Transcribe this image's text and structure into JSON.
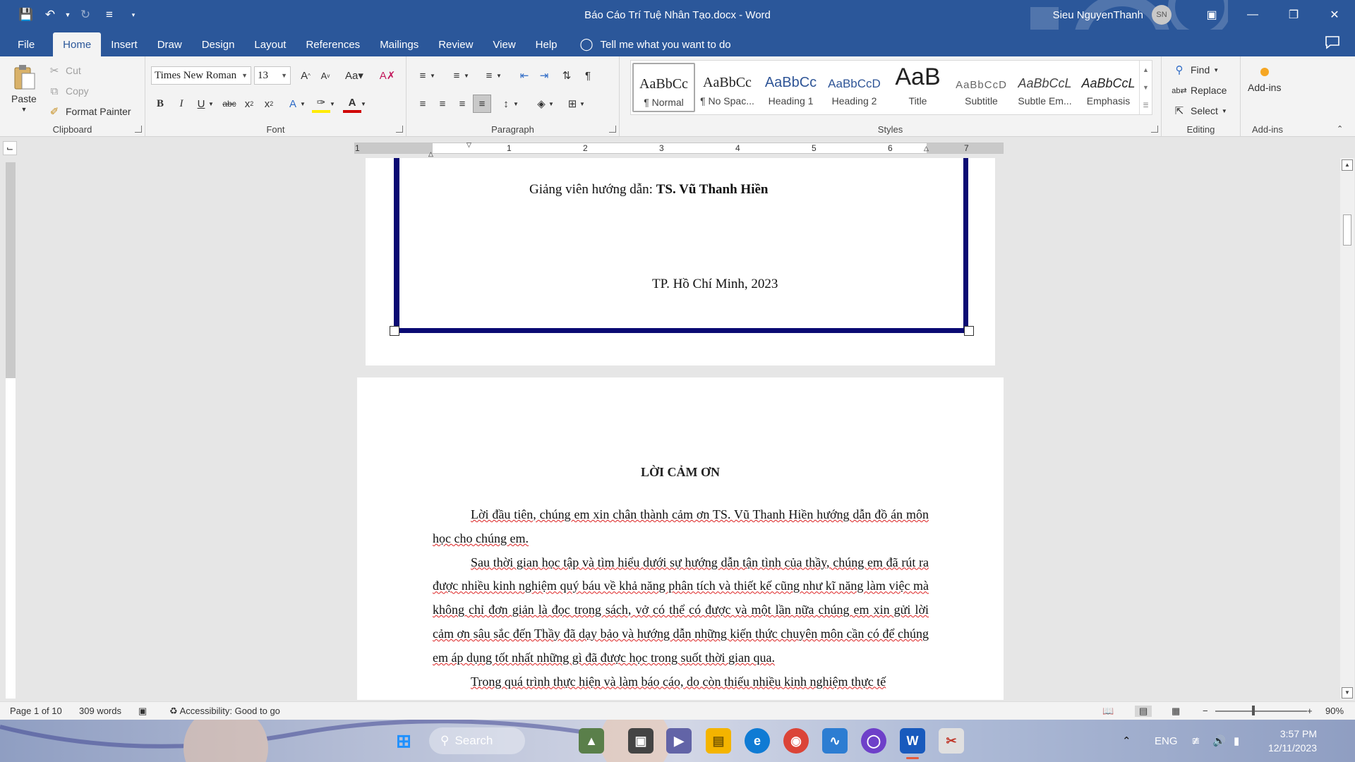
{
  "window": {
    "doc_title": "Báo Cáo Trí Tuệ Nhân Tạo.docx  -  Word",
    "user_name": "Sieu NguyenThanh",
    "user_initials": "SN"
  },
  "menu": {
    "tabs": [
      "File",
      "Home",
      "Insert",
      "Draw",
      "Design",
      "Layout",
      "References",
      "Mailings",
      "Review",
      "View",
      "Help"
    ],
    "tell_me": "Tell me what you want to do"
  },
  "ribbon": {
    "clipboard": {
      "label": "Clipboard",
      "paste": "Paste",
      "cut": "Cut",
      "copy": "Copy",
      "format_painter": "Format Painter"
    },
    "font": {
      "label": "Font",
      "font_name": "Times New Roman",
      "font_size": "13"
    },
    "paragraph": {
      "label": "Paragraph"
    },
    "styles": {
      "label": "Styles",
      "items": [
        {
          "preview": "AaBbCc",
          "name": "¶ Normal"
        },
        {
          "preview": "AaBbCc",
          "name": "¶ No Spac..."
        },
        {
          "preview": "AaBbCc",
          "name": "Heading 1"
        },
        {
          "preview": "AaBbCcD",
          "name": "Heading 2"
        },
        {
          "preview": "AaB",
          "name": "Title"
        },
        {
          "preview": "AaBbCcD",
          "name": "Subtitle"
        },
        {
          "preview": "AaBbCcL",
          "name": "Subtle Em..."
        },
        {
          "preview": "AaBbCcL",
          "name": "Emphasis"
        }
      ]
    },
    "editing": {
      "label": "Editing",
      "find": "Find",
      "replace": "Replace",
      "select": "Select"
    },
    "addins": {
      "label": "Add-ins",
      "button": "Add-ins"
    }
  },
  "ruler": {
    "numbers": [
      "1",
      "1",
      "2",
      "3",
      "4",
      "5",
      "6",
      "7"
    ]
  },
  "page1": {
    "supervisor_label": "Giảng viên hướng dẫn: ",
    "supervisor_name": "TS. Vũ Thanh Hiền",
    "place_date": "TP. Hồ Chí Minh, 2023"
  },
  "page2": {
    "heading": "LỜI CẢM ƠN",
    "paragraphs": [
      "Lời đầu tiên, chúng em xin chân thành cảm ơn TS. Vũ Thanh Hiền hướng dẫn đồ án môn học cho chúng em.",
      "Sau thời gian học tập và tìm hiểu dưới sự hướng dẫn tận tình của thầy, chúng em đã rút ra được nhiều kinh nghiệm quý báu về khả năng phân tích và thiết kế cũng như kĩ năng làm việc mà không chỉ đơn giản là đọc trong sách, vở có thể có được và một lần nữa chúng em xin gửi lời cảm ơn sâu sắc đến Thầy đã dạy bảo và hướng dẫn những kiến thức chuyên môn cần có để chúng em áp dụng tốt nhất những gì đã được học trong suốt thời gian qua.",
      "Trong quá trình thực hiện và làm báo cáo, do còn thiếu nhiều kinh nghiệm thực tế"
    ]
  },
  "status": {
    "page": "Page 1 of 10",
    "words": "309 words",
    "accessibility": "Accessibility: Good to go",
    "zoom": "90%"
  },
  "taskbar": {
    "search": "Search",
    "language": "ENG",
    "time": "3:57 PM",
    "date": "12/11/2023"
  },
  "colors": {
    "word_blue": "#2b579a",
    "frame_navy": "#0a0a73"
  }
}
